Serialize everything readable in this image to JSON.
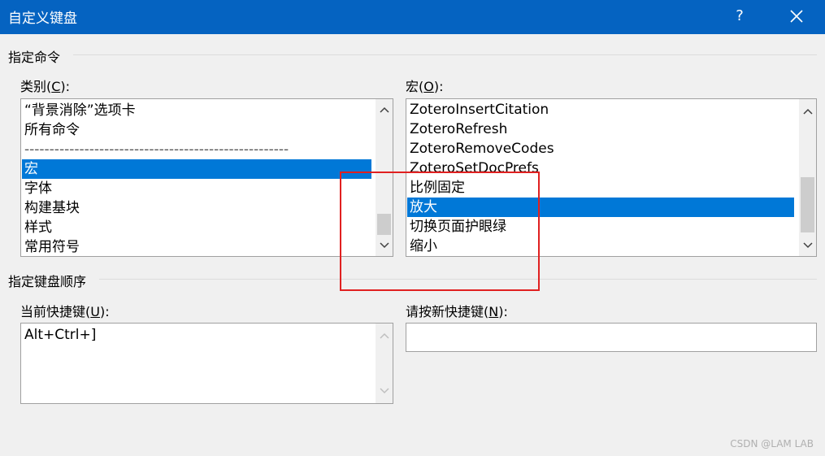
{
  "window": {
    "title": "自定义键盘",
    "help_label": "?"
  },
  "specify_command": {
    "group_label": "指定命令",
    "categories": {
      "label_prefix": "类别(",
      "label_key": "C",
      "label_suffix": "):",
      "items": [
        "“背景消除”选项卡",
        "所有命令",
        "-----------------------------------------------------",
        "宏",
        "字体",
        "构建基块",
        "样式",
        "常用符号"
      ],
      "selected_index": 3
    },
    "macros": {
      "label_prefix": "宏(",
      "label_key": "O",
      "label_suffix": "):",
      "items": [
        "ZoteroInsertCitation",
        "ZoteroRefresh",
        "ZoteroRemoveCodes",
        "ZoteroSetDocPrefs",
        "比例固定",
        "放大",
        "切换页面护眼绿",
        "缩小"
      ],
      "selected_index": 5
    }
  },
  "keyboard_sequence": {
    "group_label": "指定键盘顺序",
    "current_keys": {
      "label_prefix": "当前快捷键(",
      "label_key": "U",
      "label_suffix": "):",
      "value": "Alt+Ctrl+]"
    },
    "new_key": {
      "label_prefix": "请按新快捷键(",
      "label_key": "N",
      "label_suffix": "):",
      "value": ""
    }
  },
  "watermark": "CSDN @LAM LAB",
  "colors": {
    "titlebar": "#0563c1",
    "selection": "#0078d7",
    "annotation_box": "#e02020"
  }
}
